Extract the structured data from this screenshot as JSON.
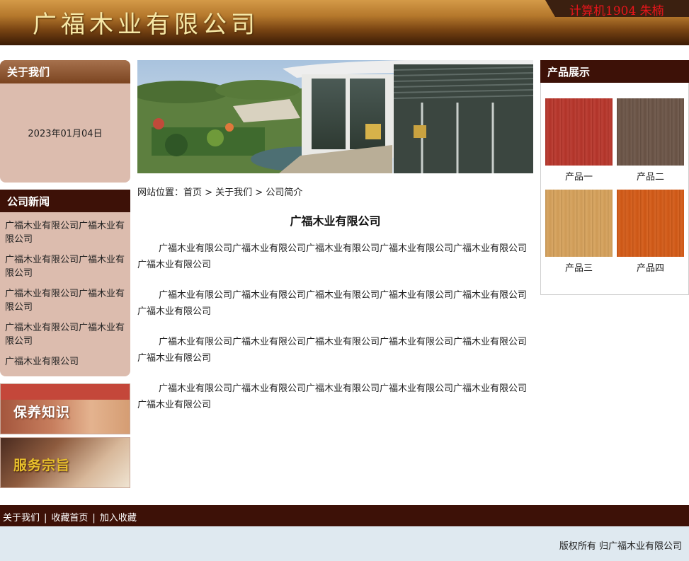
{
  "header": {
    "title": "广福木业有限公司",
    "tag": "计算机1904 朱楠"
  },
  "about": {
    "heading": "关于我们",
    "date": "2023年01月04日"
  },
  "news": {
    "heading": "公司新闻",
    "items": [
      "广福木业有限公司广福木业有限公司",
      "广福木业有限公司广福木业有限公司",
      "广福木业有限公司广福木业有限公司",
      "广福木业有限公司广福木业有限公司",
      "广福木业有限公司"
    ]
  },
  "banners": [
    {
      "label": "保养知识"
    },
    {
      "label": "服务宗旨"
    }
  ],
  "breadcrumb": "网站位置：首页 > 关于我们 > 公司简介",
  "article": {
    "title": "广福木业有限公司",
    "paragraphs": [
      "广福木业有限公司广福木业有限公司广福木业有限公司广福木业有限公司广福木业有限公司广福木业有限公司",
      "广福木业有限公司广福木业有限公司广福木业有限公司广福木业有限公司广福木业有限公司广福木业有限公司",
      "广福木业有限公司广福木业有限公司广福木业有限公司广福木业有限公司广福木业有限公司广福木业有限公司",
      "广福木业有限公司广福木业有限公司广福木业有限公司广福木业有限公司广福木业有限公司广福木业有限公司"
    ]
  },
  "products": {
    "heading": "产品展示",
    "items": [
      {
        "name": "产品一",
        "color": "#b8352a"
      },
      {
        "name": "产品二",
        "color": "#6b5446"
      },
      {
        "name": "产品三",
        "color": "#d6a15a"
      },
      {
        "name": "产品四",
        "color": "#d45a16"
      }
    ]
  },
  "footer": {
    "links": [
      "关于我们",
      "收藏首页",
      "加入收藏"
    ],
    "separator": "|",
    "copyright": "版权所有 归广福木业有限公司"
  }
}
